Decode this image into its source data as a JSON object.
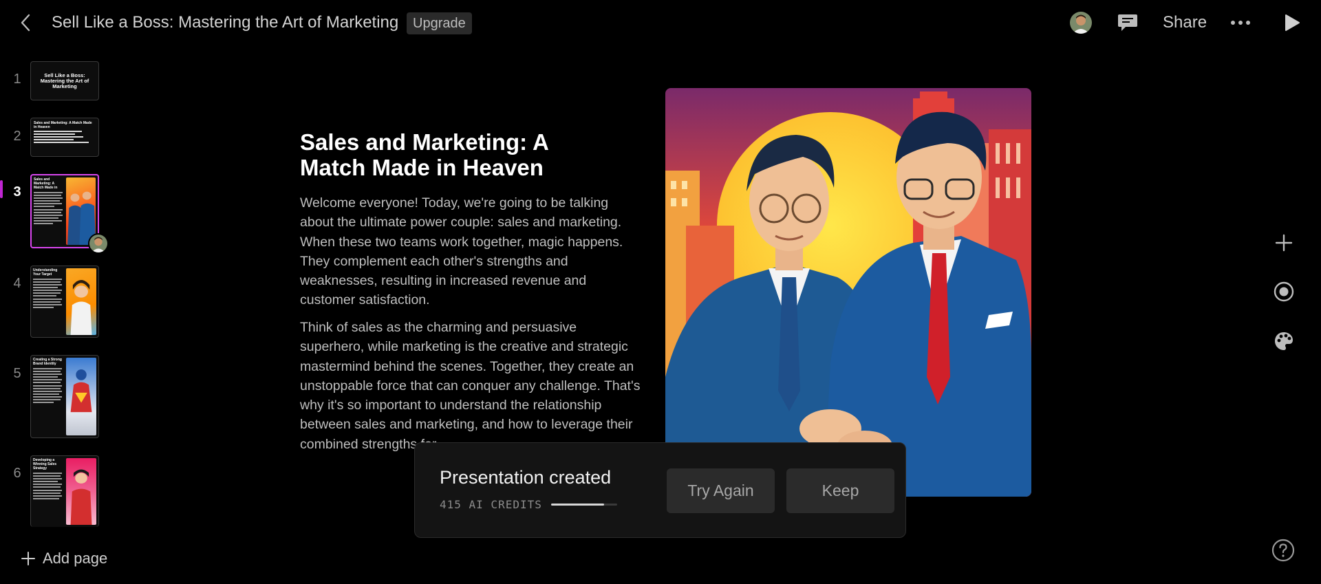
{
  "header": {
    "title": "Sell Like a Boss: Mastering the Art of Marketing",
    "upgrade_label": "Upgrade",
    "share_label": "Share",
    "icons": {
      "back": "chevron-left-icon",
      "comment": "comment-icon",
      "more": "more-icon",
      "play": "play-icon"
    }
  },
  "sidebar": {
    "slides": [
      {
        "number": "1",
        "title": "Sell Like a Boss: Mastering the Art of Marketing"
      },
      {
        "number": "2",
        "title": "Sales and Marketing: A Match Made in Heaven"
      },
      {
        "number": "3",
        "title": "Sales and Marketing: A Match Made in Heaven",
        "active": true
      },
      {
        "number": "4",
        "title": "Understanding Your Target Audience"
      },
      {
        "number": "5",
        "title": "Creating a Strong Brand Identity"
      },
      {
        "number": "6",
        "title": "Developing a Winning Sales Strategy"
      }
    ],
    "add_page_label": "Add page"
  },
  "slide": {
    "heading": "Sales and Marketing: A Match Made in Heaven",
    "paragraph_1": "Welcome everyone! Today, we're going to be talking about the ultimate power couple: sales and marketing. When these two teams work together, magic happens. They complement each other's strengths and weaknesses, resulting in increased revenue and customer satisfaction.",
    "paragraph_2": "Think of sales as the charming and persuasive superhero, while marketing is the creative and strategic mastermind behind the scenes. Together, they create an unstoppable force that can conquer any challenge. That's why it's so important to understand the relationship between sales and marketing, and how to leverage their combined strengths for"
  },
  "rail": {
    "icons": [
      "plus-icon",
      "record-icon",
      "palette-icon"
    ],
    "help_icon": "help-icon"
  },
  "toast": {
    "title": "Presentation created",
    "credits": "415 AI CREDITS",
    "credits_fraction": 0.8,
    "try_again_label": "Try Again",
    "keep_label": "Keep"
  },
  "colors": {
    "accent": "#d946ef",
    "background": "#000000"
  }
}
